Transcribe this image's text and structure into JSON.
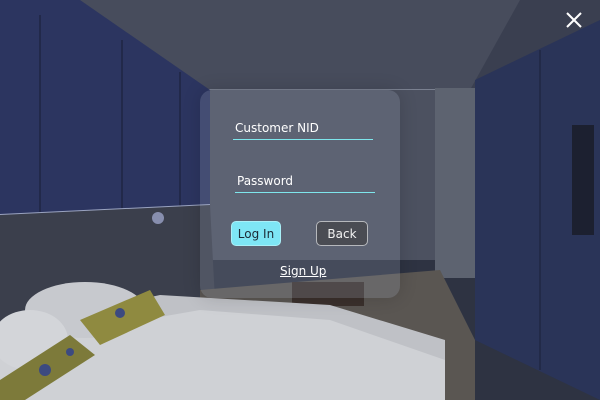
{
  "login": {
    "customer_nid_placeholder": "Customer NID",
    "customer_nid_value": "",
    "password_placeholder": "Password",
    "password_value": "",
    "login_button": "Log In",
    "back_button": "Back",
    "signup_link": "Sign Up"
  },
  "window": {
    "close_icon": "close-icon"
  },
  "colors": {
    "accent": "#7ee6f5",
    "underline": "#7ee6ec",
    "text": "#ffffff",
    "back_button_bg": "#46484e"
  }
}
